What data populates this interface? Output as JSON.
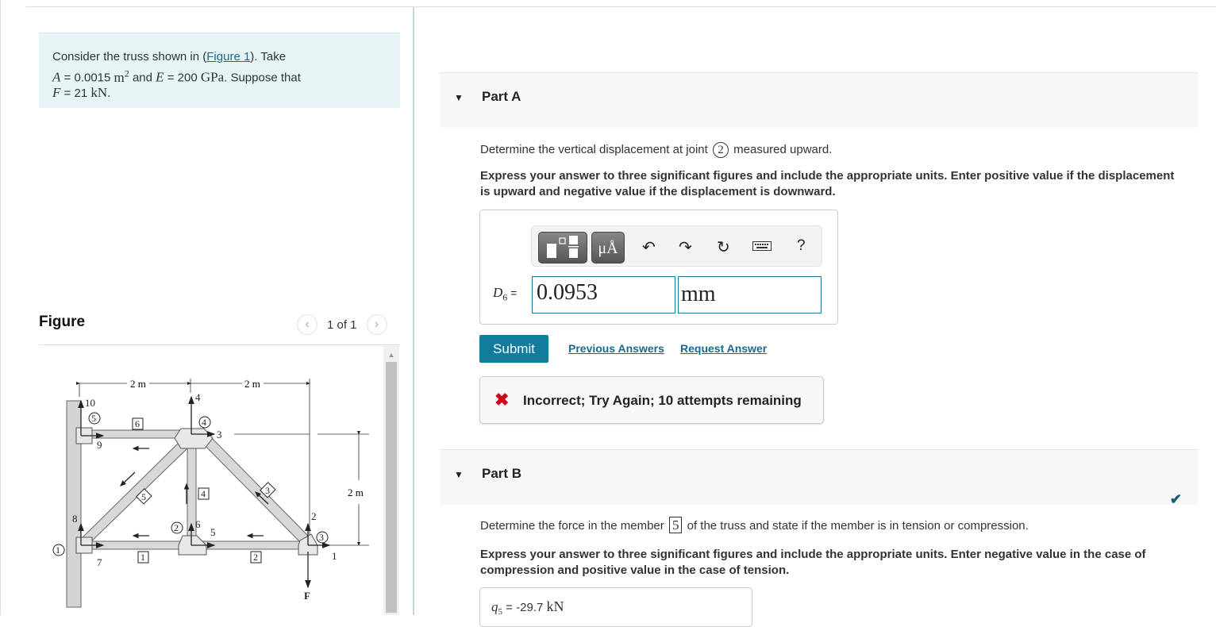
{
  "problem": {
    "intro": "Consider the truss shown in (",
    "figure_link": "Figure 1",
    "intro_after": "). Take",
    "A_symbol": "A",
    "A_value": " = 0.0015 ",
    "A_unit": "m",
    "A_exp": "2",
    "and": " and ",
    "E_symbol": "E",
    "E_value": " = 200 ",
    "E_unit": "GPa",
    "suppose": ". Suppose that",
    "F_symbol": "F",
    "F_value": " = 21 ",
    "F_unit": "kN",
    "period": "."
  },
  "figure": {
    "title": "Figure",
    "counter": "1 of 1",
    "prev_icon": "chevron-left-icon",
    "next_icon": "chevron-right-icon",
    "labels": {
      "dim_left": "2 m",
      "dim_right": "2 m",
      "dim_height": "2 m",
      "force": "F",
      "nodes": [
        "1",
        "2",
        "3",
        "4",
        "5"
      ],
      "members": [
        "1",
        "2",
        "3",
        "4",
        "5",
        "6"
      ],
      "dofs": [
        "1",
        "2",
        "3",
        "4",
        "5",
        "6",
        "7",
        "8",
        "9",
        "10"
      ]
    }
  },
  "partA": {
    "label": "Part A",
    "question_pre": "Determine the vertical displacement at joint ",
    "joint": "2",
    "question_post": " measured upward.",
    "instructions": "Express your answer to three significant figures and include the appropriate units. Enter positive value if the displacement is upward and negative value if the displacement is downward.",
    "toolbar": {
      "templates_icon": "templates-icon",
      "units_label": "μÅ",
      "undo_icon": "undo-icon",
      "redo_icon": "redo-icon",
      "reset_icon": "reset-icon",
      "keyboard_icon": "keyboard-icon",
      "help_label": "?"
    },
    "field_symbol": "D",
    "field_sub": "6",
    "field_eq": " =",
    "value": "0.0953",
    "unit": "mm",
    "submit_label": "Submit",
    "previous_answers": "Previous Answers",
    "request_answer": "Request Answer",
    "feedback": "Incorrect; Try Again; 10 attempts remaining"
  },
  "partB": {
    "label": "Part B",
    "status": "correct",
    "question_pre": "Determine the force in the member ",
    "member": "5",
    "question_post": " of the truss and state if the member is in tension or compression.",
    "instructions": "Express your answer to three significant figures and include the appropriate units. Enter negative value in the case of compression and positive value in the case of tension.",
    "field_symbol": "q",
    "field_sub": "5",
    "field_eq": " = ",
    "value": "-29.7 ",
    "unit": "kN"
  },
  "colors": {
    "accent": "#137c9c",
    "link": "#1a6a8c",
    "error": "#d0021b",
    "problem_bg": "#e6f6f6"
  }
}
